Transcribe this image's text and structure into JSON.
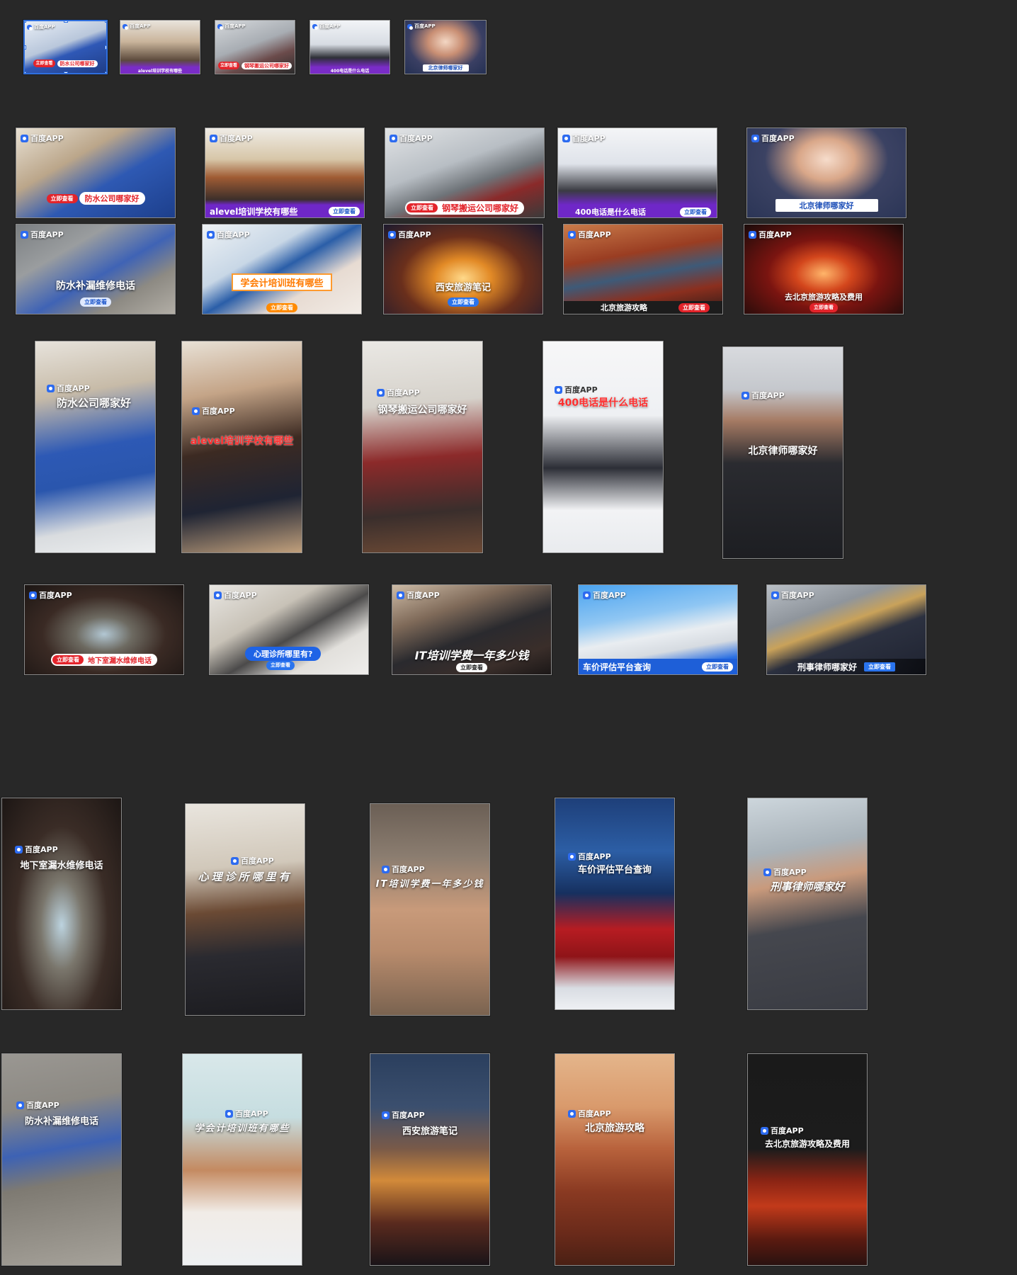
{
  "brand_label": "百度APP",
  "cta_label": "立即查看",
  "thumbs": [
    {
      "headline": "防水公司哪家好"
    },
    {
      "headline": "alevel培训学校有哪些"
    },
    {
      "headline": "钢琴搬运公司哪家好"
    },
    {
      "headline": "400电话是什么电话"
    },
    {
      "headline": "北京律师哪家好"
    }
  ],
  "row1": [
    {
      "headline": "防水公司哪家好"
    },
    {
      "headline": "alevel培训学校有哪些"
    },
    {
      "headline": "钢琴搬运公司哪家好"
    },
    {
      "headline": "400电话是什么电话"
    },
    {
      "headline": "北京律师哪家好"
    }
  ],
  "row2": [
    {
      "headline": "防水补漏维修电话"
    },
    {
      "headline": "学会计培训班有哪些"
    },
    {
      "headline": "西安旅游笔记"
    },
    {
      "headline": "北京旅游攻略"
    },
    {
      "headline": "去北京旅游攻略及费用"
    }
  ],
  "row3": [
    {
      "headline": "防水公司哪家好"
    },
    {
      "headline": "alevel培训学校有哪些"
    },
    {
      "headline": "钢琴搬运公司哪家好"
    },
    {
      "headline": "400电话是什么电话"
    },
    {
      "headline": "北京律师哪家好"
    }
  ],
  "row4": [
    {
      "headline": "地下室漏水维修电话"
    },
    {
      "headline": "心理诊所哪里有?"
    },
    {
      "headline": "IT培训学费一年多少钱"
    },
    {
      "headline": "车价评估平台查询"
    },
    {
      "headline": "刑事律师哪家好"
    }
  ],
  "row5": [
    {
      "headline": "地下室漏水维修电话"
    },
    {
      "headline": "心理诊所哪里有"
    },
    {
      "headline": "IT培训学费一年多少钱"
    },
    {
      "headline": "车价评估平台查询"
    },
    {
      "headline": "刑事律师哪家好"
    }
  ],
  "row6": [
    {
      "headline": "防水补漏维修电话"
    },
    {
      "headline": "学会计培训班有哪些"
    },
    {
      "headline": "西安旅游笔记"
    },
    {
      "headline": "北京旅游攻略"
    },
    {
      "headline": "去北京旅游攻略及费用"
    }
  ]
}
